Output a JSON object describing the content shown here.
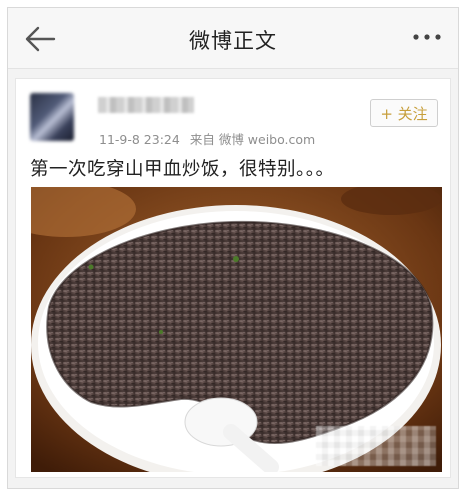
{
  "navbar": {
    "title": "微博正文",
    "back_icon": "back-arrow-icon",
    "more_icon": "more-dots-icon"
  },
  "post": {
    "timestamp": "11-9-8 23:24",
    "source": "来自 微博 weibo.com",
    "follow_label": "+ 关注",
    "text": "第一次吃穿山甲血炒饭，很特别。。。",
    "colors": {
      "follow_text": "#c79f3b",
      "meta_text": "#8e8e8e"
    }
  }
}
